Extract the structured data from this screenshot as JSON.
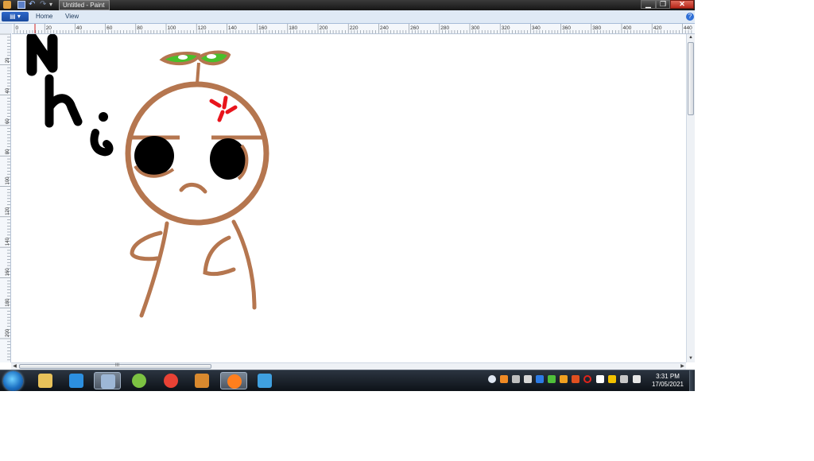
{
  "window": {
    "title": "Untitled - Paint",
    "min_glyph": "▁",
    "max_glyph": "❐",
    "close_glyph": "✕"
  },
  "quick_access": {
    "undo_glyph": "↶",
    "redo_glyph": "↷",
    "more_glyph": "▾"
  },
  "ribbon": {
    "file_label": "▤ ▾",
    "tabs": [
      {
        "label": "Home"
      },
      {
        "label": "View"
      }
    ],
    "help_glyph": "?"
  },
  "ruler": {
    "horizontal_labels": [
      "0",
      "20",
      "40",
      "60",
      "80",
      "100",
      "120",
      "140",
      "160",
      "180",
      "200",
      "220",
      "240",
      "260",
      "280",
      "300",
      "320",
      "340",
      "360",
      "380",
      "400",
      "420",
      "440"
    ],
    "vertical_labels": [
      "20",
      "40",
      "60",
      "80",
      "100",
      "120",
      "140",
      "160",
      "180",
      "200"
    ]
  },
  "drawing": {
    "text": "N h.",
    "colors": {
      "outline": "#b5764f",
      "ink": "#000000",
      "anger_mark": "#e8141c",
      "leaf": "#48c02a",
      "leaf_outline": "#b5764f"
    }
  },
  "scrollbar": {
    "up_glyph": "▲",
    "down_glyph": "▼",
    "left_glyph": "◀",
    "right_glyph": "▶",
    "grip_glyph": "III"
  },
  "taskbar": {
    "items": [
      {
        "icon": "file-explorer-icon",
        "color": "#e8c25a",
        "active": false
      },
      {
        "icon": "internet-explorer-icon",
        "color": "#2c8fe0",
        "active": false
      },
      {
        "icon": "paint-icon",
        "color": "#9db7d6",
        "active": true
      },
      {
        "icon": "app-green-icon",
        "color": "#7cc242",
        "active": false
      },
      {
        "icon": "chrome-icon",
        "color": "#e94235",
        "active": false
      },
      {
        "icon": "archive-icon",
        "color": "#d9892e",
        "active": false
      },
      {
        "icon": "firefox-icon",
        "color": "#ff7f1e",
        "active": true
      },
      {
        "icon": "messenger-icon",
        "color": "#3fa0e0",
        "active": false
      }
    ],
    "tray_icons": [
      {
        "icon": "chat-tray-icon",
        "color": "#dfe7f2"
      },
      {
        "icon": "tool-tray-icon",
        "color": "#f08a24"
      },
      {
        "icon": "app-tray-icon",
        "color": "#bfbfbf"
      },
      {
        "icon": "monitor-tray-icon",
        "color": "#d6d6d6"
      },
      {
        "icon": "bluetooth-tray-icon",
        "color": "#2c7be5"
      },
      {
        "icon": "evernote-tray-icon",
        "color": "#4fbf3a"
      },
      {
        "icon": "shield-tray-icon",
        "color": "#f0a020"
      },
      {
        "icon": "sync-tray-icon",
        "color": "#e05020"
      },
      {
        "icon": "opera-tray-icon",
        "color": "#e2231a"
      },
      {
        "icon": "flag-tray-icon",
        "color": "#ffffff"
      },
      {
        "icon": "network-tray-icon",
        "color": "#f2c200"
      },
      {
        "icon": "signal-tray-icon",
        "color": "#c8c8c8"
      },
      {
        "icon": "volume-tray-icon",
        "color": "#e6e6e6"
      }
    ],
    "clock_time": "3:31 PM",
    "clock_date": "17/05/2021"
  }
}
